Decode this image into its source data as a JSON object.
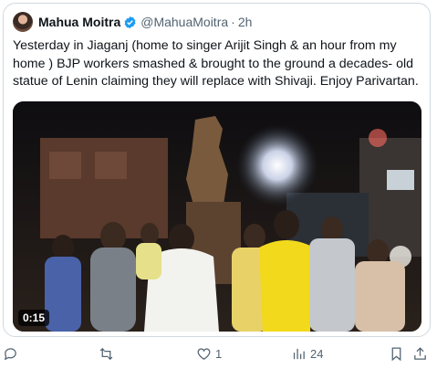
{
  "tweet": {
    "author_name": "Mahua Moitra",
    "handle": "@MahuaMoitra",
    "separator": "·",
    "time": "2h",
    "text": "Yesterday in Jiaganj (home to singer Arijit Singh & an hour from my home ) BJP workers smashed & brought to the ground a decades- old statue of Lenin claiming they will replace with Shivaji. Enjoy Parivartan.",
    "video_duration": "0:15"
  },
  "actions": {
    "reply_count": "",
    "retweet_count": "",
    "like_count": "1",
    "views_count": "24"
  },
  "colors": {
    "text": "#0f1419",
    "secondary": "#536471",
    "verified": "#1d9bf0",
    "border": "#cfd9de"
  },
  "icons": [
    "verified-badge-icon",
    "reply-icon",
    "retweet-icon",
    "like-icon",
    "views-icon",
    "bookmark-icon",
    "share-icon"
  ]
}
